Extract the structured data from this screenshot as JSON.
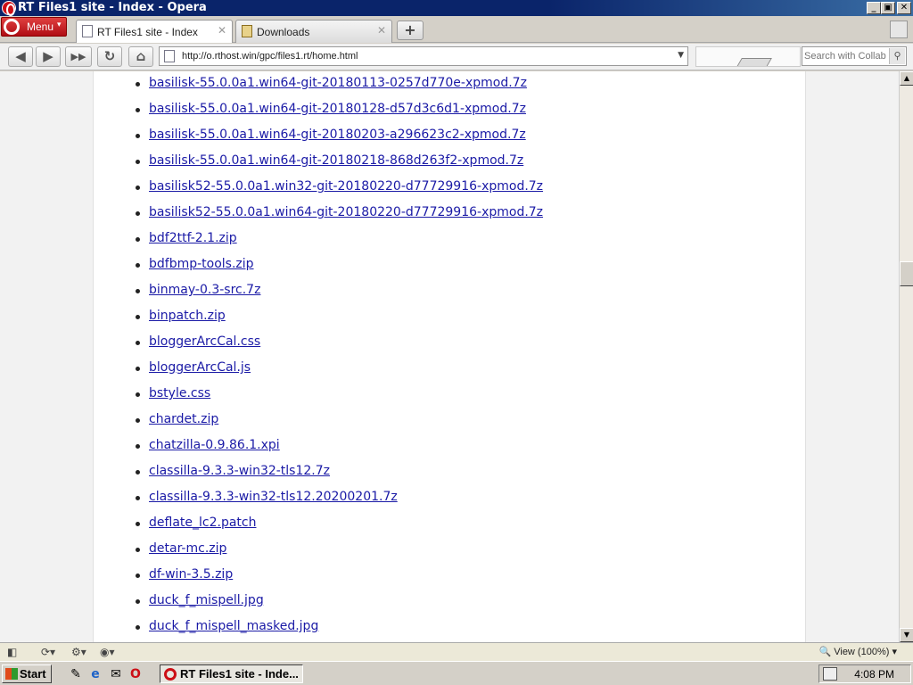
{
  "window": {
    "title": "RT Files1 site - Index - Opera",
    "controls": {
      "minimize": "_",
      "maximize": "▣",
      "close": "✕"
    }
  },
  "menu": {
    "label": "Menu",
    "arrow": "▾"
  },
  "tabs": [
    {
      "label": "RT Files1 site - Index",
      "icon": "page-icon",
      "active": true,
      "close": "✕"
    },
    {
      "label": "Downloads",
      "icon": "downloads-icon",
      "active": false,
      "close": "✕"
    }
  ],
  "new_tab": "+",
  "nav": {
    "back": "◀",
    "forward": "▶",
    "fast_forward": "▶▶",
    "reload": "↻",
    "home": "⌂",
    "url": "http://o.rthost.win/gpc/files1.rt/home.html",
    "url_dropdown": "▼",
    "search_placeholder": "Search with Collab",
    "search_icon": "⚲"
  },
  "files": [
    "basilisk-55.0.0a1.win64-git-20180113-0257d770e-xpmod.7z",
    "basilisk-55.0.0a1.win64-git-20180128-d57d3c6d1-xpmod.7z",
    "basilisk-55.0.0a1.win64-git-20180203-a296623c2-xpmod.7z",
    "basilisk-55.0.0a1.win64-git-20180218-868d263f2-xpmod.7z",
    "basilisk52-55.0.0a1.win32-git-20180220-d77729916-xpmod.7z",
    "basilisk52-55.0.0a1.win64-git-20180220-d77729916-xpmod.7z",
    "bdf2ttf-2.1.zip",
    "bdfbmp-tools.zip",
    "binmay-0.3-src.7z",
    "binpatch.zip",
    "bloggerArcCal.css",
    "bloggerArcCal.js",
    "bstyle.css",
    "chardet.zip",
    "chatzilla-0.9.86.1.xpi",
    "classilla-9.3.3-win32-tls12.7z",
    "classilla-9.3.3-win32-tls12.20200201.7z",
    "deflate_lc2.patch",
    "detar-mc.zip",
    "df-win-3.5.zip",
    "duck_f_mispell.jpg",
    "duck_f_mispell_masked.jpg"
  ],
  "scrollbar": {
    "up": "▲",
    "down": "▼",
    "position_fraction": 0.34
  },
  "status": {
    "panel_toggle": "◧",
    "sync": "⟳▾",
    "share": "⚙▾",
    "turbo": "◉▾",
    "zoom_icon": "🔍",
    "zoom": "View (100%)",
    "zoom_arrow": "▾"
  },
  "taskbar": {
    "start_label": "Start",
    "quick_launch": [
      "✎",
      "e",
      "✉",
      "O"
    ],
    "task_label": "RT Files1 site - Inde...",
    "clock": "4:08 PM"
  }
}
